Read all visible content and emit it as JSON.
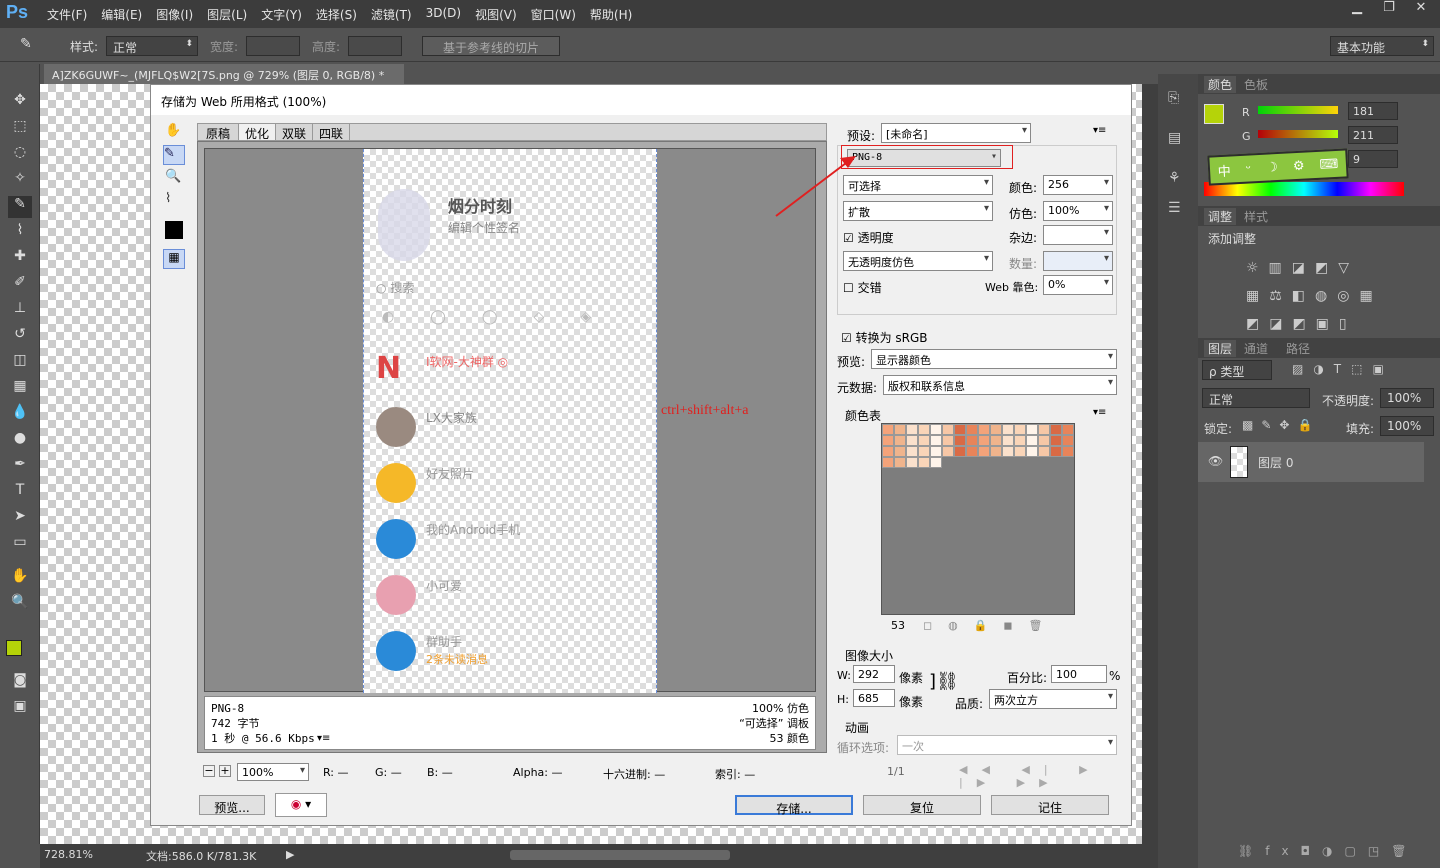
{
  "app": {
    "logo": "Ps"
  },
  "menu": [
    "文件(F)",
    "编辑(E)",
    "图像(I)",
    "图层(L)",
    "文字(Y)",
    "选择(S)",
    "滤镜(T)",
    "3D(D)",
    "视图(V)",
    "窗口(W)",
    "帮助(H)"
  ],
  "window_controls": [
    "▁",
    "❐",
    "✕"
  ],
  "options": {
    "style_label": "样式:",
    "style_value": "正常",
    "width_label": "宽度:",
    "height_label": "高度:",
    "slice_btn": "基于参考线的切片",
    "workspace": "基本功能"
  },
  "doc_tab": {
    "title": "A]ZK6GUWF~_(MJFLQ$W2[7S.png @ 729% (图层 0, RGB/8) *",
    "close": "×"
  },
  "status": {
    "zoom": "728.81%",
    "doc": "文档:586.0 K/781.3K",
    "arrow": "▶"
  },
  "dialog": {
    "title": "存储为 Web 所用格式 (100%)",
    "tabs": [
      "原稿",
      "优化",
      "双联",
      "四联"
    ],
    "preview": {
      "username": "烟分时刻",
      "signature": "编辑个性签名",
      "search": "搜索",
      "contacts": [
        {
          "name": "I软网-大神群 ◎",
          "msg": ""
        },
        {
          "name": "LX大家族",
          "msg": ""
        },
        {
          "name": "好友照片",
          "msg": ""
        },
        {
          "name": "我的Android手机",
          "msg": ""
        },
        {
          "name": "小可爱",
          "msg": ""
        },
        {
          "name": "群助手",
          "msg": "2条未读消息"
        }
      ]
    },
    "info_left": [
      "PNG-8",
      "742 字节",
      "1 秒 @ 56.6 Kbps"
    ],
    "info_right": [
      "100% 仿色",
      "“可选择” 调板",
      "53 颜色"
    ],
    "annotation": "ctrl+shift+alt+a",
    "preset_label": "预设:",
    "preset_value": "[未命名]",
    "format": "PNG-8",
    "reduction": "可选择",
    "colors_label": "颜色:",
    "colors_value": "256",
    "dither": "扩散",
    "dither_label": "仿色:",
    "dither_value": "100%",
    "transparency": "透明度",
    "matte_label": "杂边:",
    "trans_dither": "无透明度仿色",
    "amount_label": "数量:",
    "interlaced": "交错",
    "websnap_label": "Web 靠色:",
    "websnap_value": "0%",
    "srgb": "转换为 sRGB",
    "preview_label": "预览:",
    "preview_value": "显示器颜色",
    "meta_label": "元数据:",
    "meta_value": "版权和联系信息",
    "color_table_label": "颜色表",
    "color_count": "53",
    "image_size_label": "图像大小",
    "w_label": "W:",
    "w_value": "292",
    "h_label": "H:",
    "h_value": "685",
    "px": "像素",
    "percent_label": "百分比:",
    "percent_value": "100",
    "percent_unit": "%",
    "quality_label": "品质:",
    "quality_value": "两次立方",
    "anim_label": "动画",
    "loop_label": "循环选项:",
    "loop_value": "一次",
    "frame": "1/1",
    "bottom": {
      "zoom": "100%",
      "r": "R: —",
      "g": "G: —",
      "b": "B: —",
      "alpha": "Alpha: —",
      "hex": "十六进制: —",
      "index": "索引: —"
    },
    "buttons": {
      "preview": "预览...",
      "save": "存储...",
      "reset": "复位",
      "remember": "记住"
    }
  },
  "panels": {
    "color_tabs": [
      "颜色",
      "色板"
    ],
    "r_label": "R",
    "g_label": "G",
    "b_label": "B",
    "r": "181",
    "g": "211",
    "b": "9",
    "fg_color": "#b5d309",
    "adjust_tabs": [
      "调整",
      "样式"
    ],
    "add_adjust": "添加调整",
    "layers_tabs": [
      "图层",
      "通道",
      "路径"
    ],
    "kind": "ρ 类型",
    "blend": "正常",
    "opacity_label": "不透明度:",
    "opacity": "100%",
    "lock_label": "锁定:",
    "fill_label": "填充:",
    "fill": "100%",
    "layer_name": "图层 0",
    "ime": [
      "中",
      "ᵕ",
      "☽",
      "⚙",
      "⌨"
    ]
  }
}
